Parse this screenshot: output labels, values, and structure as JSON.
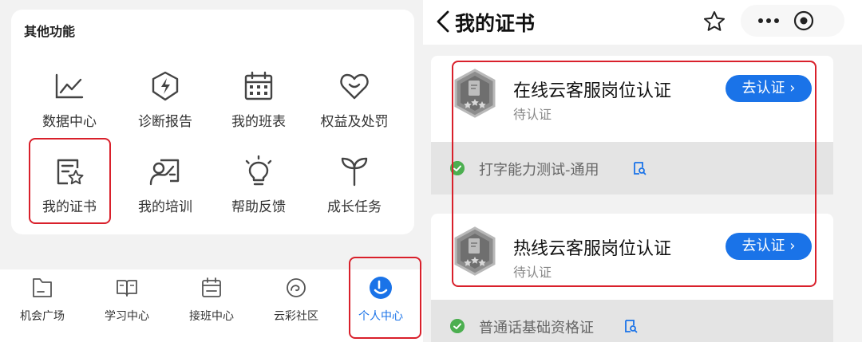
{
  "left": {
    "section_title": "其他功能",
    "functions": [
      {
        "label": "数据中心",
        "icon": "line-chart-icon"
      },
      {
        "label": "诊断报告",
        "icon": "lightning-shield-icon"
      },
      {
        "label": "我的班表",
        "icon": "calendar-icon"
      },
      {
        "label": "权益及处罚",
        "icon": "heart-smile-icon"
      },
      {
        "label": "我的证书",
        "icon": "certificate-star-icon"
      },
      {
        "label": "我的培训",
        "icon": "trainer-board-icon"
      },
      {
        "label": "帮助反馈",
        "icon": "lightbulb-icon"
      },
      {
        "label": "成长任务",
        "icon": "sprout-icon"
      }
    ],
    "tabs": [
      {
        "label": "机会广场",
        "icon": "folder-icon"
      },
      {
        "label": "学习中心",
        "icon": "book-icon"
      },
      {
        "label": "接班中心",
        "icon": "calendar-icon"
      },
      {
        "label": "云彩社区",
        "icon": "cloud-swirl-icon"
      },
      {
        "label": "个人中心",
        "icon": "person-icon",
        "active": true
      }
    ],
    "highlight_color": "#d9202b",
    "active_color": "#1a73e8"
  },
  "right": {
    "nav_title": "我的证书",
    "certificates": [
      {
        "name": "在线云客服岗位认证",
        "status": "待认证",
        "button": "去认证 ›",
        "requirement": "打字能力测试-通用"
      },
      {
        "name": "热线云客服岗位认证",
        "status": "待认证",
        "button": "去认证 ›",
        "requirement": "普通话基础资格证"
      }
    ],
    "button_color": "#1a73e8",
    "check_color": "#4caf50"
  }
}
